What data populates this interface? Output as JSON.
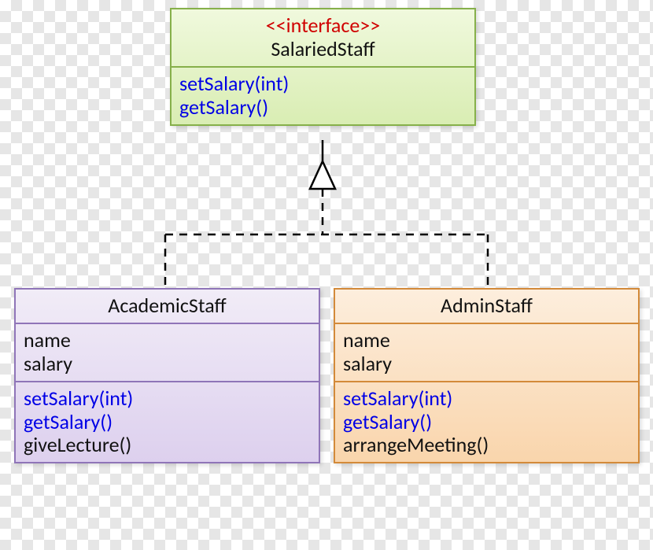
{
  "interface": {
    "stereotype": "<<interface>>",
    "name": "SalariedStaff",
    "methods": [
      "setSalary(int)",
      "getSalary()"
    ]
  },
  "classes": {
    "academic": {
      "name": "AcademicStaff",
      "attributes": [
        "name",
        "salary"
      ],
      "methods": {
        "inherited": [
          "setSalary(int)",
          "getSalary()"
        ],
        "own": [
          "giveLecture()"
        ]
      }
    },
    "admin": {
      "name": "AdminStaff",
      "attributes": [
        "name",
        "salary"
      ],
      "methods": {
        "inherited": [
          "setSalary(int)",
          "getSalary()"
        ],
        "own": [
          "arrangeMeeting()"
        ]
      }
    }
  },
  "relations": [
    {
      "type": "realization",
      "from": "academic",
      "to": "interface"
    },
    {
      "type": "realization",
      "from": "admin",
      "to": "interface"
    }
  ]
}
